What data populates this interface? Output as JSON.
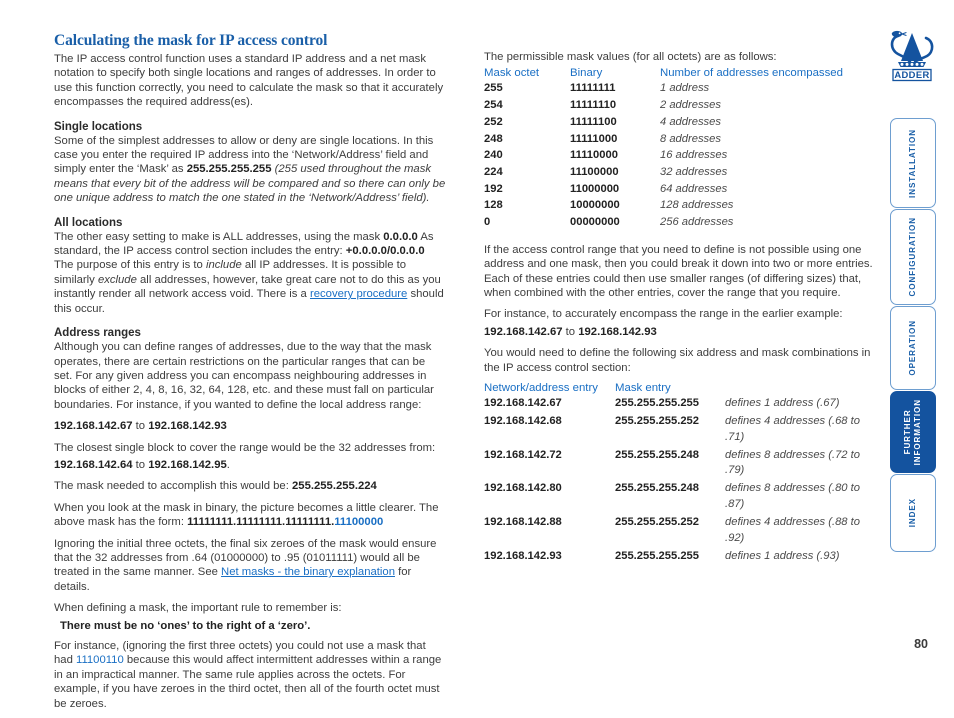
{
  "page": {
    "number": "80",
    "brand": "ADDER"
  },
  "left": {
    "title": "Calculating the mask for IP access control",
    "intro": {
      "p1_a": "The IP access control function uses a standard IP address and a net mask notation to specify both single locations and ranges of addresses. In order to use this function correctly, you need to calculate the mask so that it accurately encompasses the required address(es)."
    },
    "single_locations": {
      "heading": "Single locations",
      "t1": "Some of the simplest addresses to allow or deny are single locations. In this case you enter the required IP address into the ‘Network/Address’ field and simply enter the ‘Mask’ as ",
      "mask_value": "255.255.255.255",
      "t2": " (255 used throughout the mask means that every bit of the address will be compared and so there can only be one unique address to match the one stated in the ‘Network/Address’ field)."
    },
    "all_locations": {
      "heading": "All locations",
      "t1": "The other easy setting to make is ALL addresses, using the mask ",
      "mask_value": "0.0.0.0",
      "t2": "  As standard, the IP access control section includes the entry: ",
      "entry_value": "+0.0.0.0/0.0.0.0",
      "t3": "The purpose of this entry is to ",
      "include_word": "include",
      "t4": " all IP addresses. It is possible to similarly ",
      "exclude_word": "exclude",
      "t5": " all addresses, however, take great care not to do this as you instantly render all network access void. There is a ",
      "link": "recovery procedure",
      "t6": " should this occur."
    },
    "address_ranges": {
      "heading": "Address ranges",
      "t1": "Although you can define ranges of addresses, due to the way that the mask operates, there are certain restrictions on the particular ranges that can be set. For any given address you can encompass neighbouring addresses in blocks of either 2, 4, 8, 16, 32, 64, 128, etc. and these must fall on particular boundaries. For instance, if you wanted to define the local address range:",
      "range_start": "192.168.142.67",
      "range_to": " to ",
      "range_end": "192.168.142.93",
      "t2": "The closest single block to cover the range would be the 32 addresses from:",
      "block_start": "192.168.142.64",
      "block_to": " to ",
      "block_end": "192.168.142.95",
      "block_period": ".",
      "t3": "The mask needed to accomplish this would be: ",
      "mask_needed": "255.255.255.224",
      "t4": "When you look at the mask in binary, the picture becomes a little clearer. The above mask has the form: ",
      "binary_prefix": "11111111.11111111.11111111.",
      "binary_suffix": "11100000",
      "t5": "Ignoring the initial three octets, the final six zeroes of the mask would ensure that the 32 addresses from .64 (01000000) to .95 (01011111) would all be treated in the same manner. See ",
      "link": "Net masks - the binary explanation",
      "t6": " for details.",
      "t7": "When defining a mask, the important rule to remember is:",
      "rule": "There must be no ‘ones’ to the right of a ‘zero’.",
      "t8": "For instance, (ignoring the first three octets) you could not use a mask that had ",
      "bad_binary": "11100110",
      "t9": " because this would affect intermittent addresses within a range in an impractical manner. The same rule applies across the octets. For example, if you have zeroes in the third octet, then all of the fourth octet must be zeroes."
    }
  },
  "right": {
    "intro": "The permissible mask values (for all octets) are as follows:",
    "mask_table": {
      "headers": [
        "Mask octet",
        "Binary",
        "Number of addresses encompassed"
      ],
      "rows": [
        [
          "255",
          "11111111",
          "1 address"
        ],
        [
          "254",
          "11111110",
          "2 addresses"
        ],
        [
          "252",
          "11111100",
          "4 addresses"
        ],
        [
          "248",
          "11111000",
          "8 addresses"
        ],
        [
          "240",
          "11110000",
          "16 addresses"
        ],
        [
          "224",
          "11100000",
          "32 addresses"
        ],
        [
          "192",
          "11000000",
          "64 addresses"
        ],
        [
          "128",
          "10000000",
          "128 addresses"
        ],
        [
          "0",
          "00000000",
          "256 addresses"
        ]
      ]
    },
    "p1": "If the access control range that you need to define is not possible using one address and one mask, then you could break it down into two or more entries. Each of these entries could then use smaller ranges (of differing sizes) that, when combined with the other entries, cover the range that you require.",
    "p2": "For instance, to accurately encompass the range in the earlier example:",
    "range_start": "192.168.142.67",
    "range_to": " to ",
    "range_end": "192.168.142.93",
    "p3": "You would need to define the following six address and mask combinations in the IP access control section:",
    "entry_table": {
      "headers": [
        "Network/address entry",
        "Mask entry"
      ],
      "rows": [
        [
          "192.168.142.67",
          "255.255.255.255",
          "defines 1 address (.67)"
        ],
        [
          "192.168.142.68",
          "255.255.255.252",
          "defines 4 addresses (.68 to .71)"
        ],
        [
          "192.168.142.72",
          "255.255.255.248",
          "defines 8 addresses (.72 to .79)"
        ],
        [
          "192.168.142.80",
          "255.255.255.248",
          "defines 8 addresses (.80 to .87)"
        ],
        [
          "192.168.142.88",
          "255.255.255.252",
          "defines 4 addresses (.88 to .92)"
        ],
        [
          "192.168.142.93",
          "255.255.255.255",
          "defines 1 address (.93)"
        ]
      ]
    }
  },
  "nav": {
    "tabs": [
      {
        "label": "INSTALLATION",
        "active": false
      },
      {
        "label": "CONFIGURATION",
        "active": false
      },
      {
        "label": "OPERATION",
        "active": false
      },
      {
        "label": "FURTHER\nINFORMATION",
        "active": true
      },
      {
        "label": "INDEX",
        "active": false
      }
    ]
  },
  "colors": {
    "brand_blue": "#14539f",
    "heading_blue": "#1a5fa8",
    "link_blue": "#1a6fc4",
    "body_text": "#3d3d3d"
  }
}
